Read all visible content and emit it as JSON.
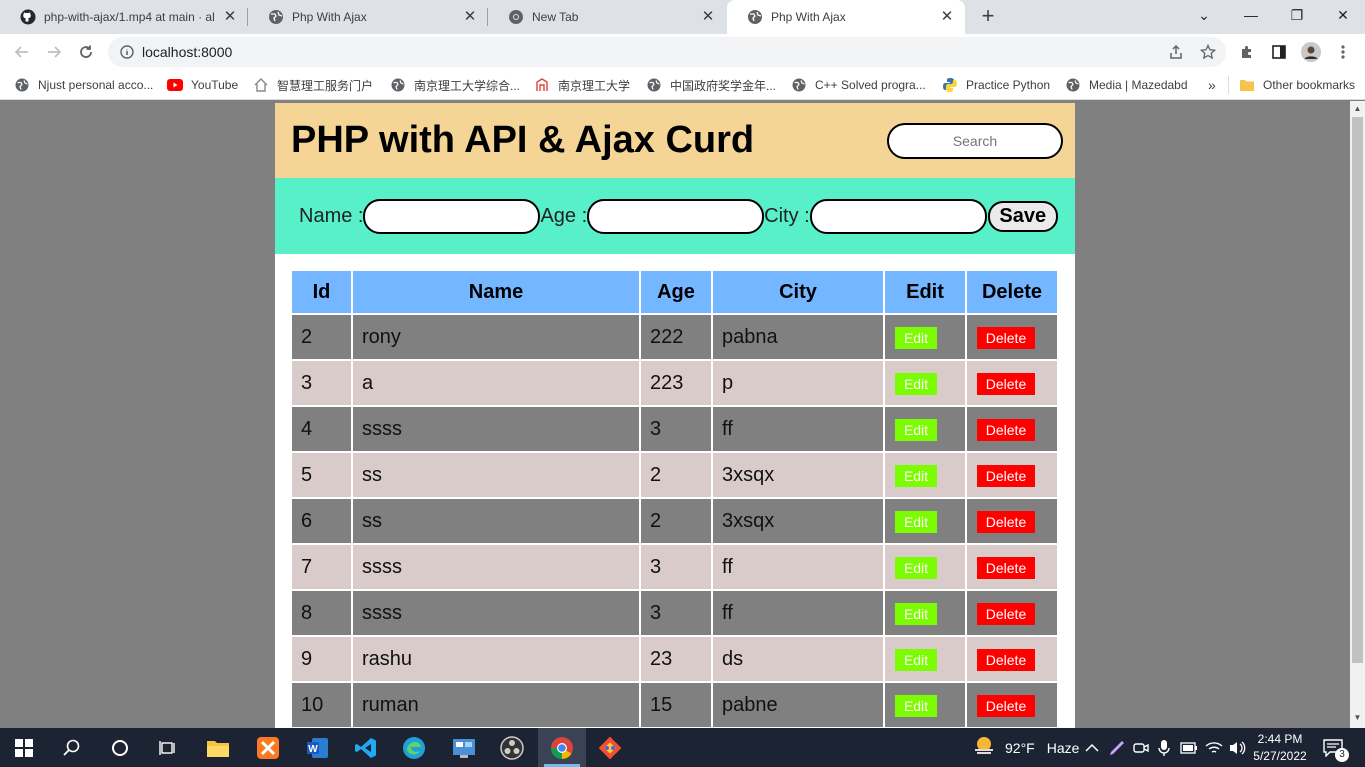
{
  "browser": {
    "tabs": [
      {
        "title": "php-with-ajax/1.mp4 at main · al",
        "icon": "github-icon"
      },
      {
        "title": "Php With Ajax",
        "icon": "globe-icon"
      },
      {
        "title": "New Tab",
        "icon": "chrome-icon"
      },
      {
        "title": "Php With Ajax",
        "icon": "globe-icon"
      }
    ],
    "url": "localhost:8000",
    "bookmarks": [
      {
        "label": "Njust personal acco...",
        "icon": "globe-icon"
      },
      {
        "label": "YouTube",
        "icon": "youtube-icon"
      },
      {
        "label": "智慧理工服务门户",
        "icon": "home-icon"
      },
      {
        "label": "南京理工大学综合...",
        "icon": "globe-icon"
      },
      {
        "label": "南京理工大学",
        "icon": "university-icon"
      },
      {
        "label": "中国政府奖学金年...",
        "icon": "globe-icon"
      },
      {
        "label": "C++ Solved progra...",
        "icon": "globe-icon"
      },
      {
        "label": "Practice Python",
        "icon": "python-icon"
      },
      {
        "label": "Media | Mazedabd",
        "icon": "globe-icon"
      }
    ],
    "more_bookmarks": "»",
    "other_bookmarks": "Other bookmarks"
  },
  "page": {
    "title": "PHP with API & Ajax Curd",
    "search_placeholder": "Search",
    "form": {
      "name_label": "Name :",
      "age_label": "Age :",
      "city_label": "City :",
      "save_label": "Save"
    },
    "table": {
      "headers": [
        "Id",
        "Name",
        "Age",
        "City",
        "Edit",
        "Delete"
      ],
      "rows": [
        {
          "id": "2",
          "name": "rony",
          "age": "222",
          "city": "pabna"
        },
        {
          "id": "3",
          "name": "a",
          "age": "223",
          "city": "p"
        },
        {
          "id": "4",
          "name": "ssss",
          "age": "3",
          "city": "ff"
        },
        {
          "id": "5",
          "name": "ss",
          "age": "2",
          "city": "3xsqx"
        },
        {
          "id": "6",
          "name": "ss",
          "age": "2",
          "city": "3xsqx"
        },
        {
          "id": "7",
          "name": "ssss",
          "age": "3",
          "city": "ff"
        },
        {
          "id": "8",
          "name": "ssss",
          "age": "3",
          "city": "ff"
        },
        {
          "id": "9",
          "name": "rashu",
          "age": "23",
          "city": "ds"
        },
        {
          "id": "10",
          "name": "ruman",
          "age": "15",
          "city": "pabne"
        }
      ],
      "edit_label": "Edit",
      "delete_label": "Delete"
    }
  },
  "taskbar": {
    "weather_temp": "92°F",
    "weather_desc": "Haze",
    "time": "2:44 PM",
    "date": "5/27/2022",
    "notification_count": "3"
  },
  "colors": {
    "header_bg": "#f4d596",
    "form_bg": "#58f0c8",
    "table_header_bg": "#74b6ff",
    "row_dark": "#808080",
    "row_light": "#d9cbca",
    "edit_button": "#7cfc00",
    "delete_button": "#ff0000"
  }
}
